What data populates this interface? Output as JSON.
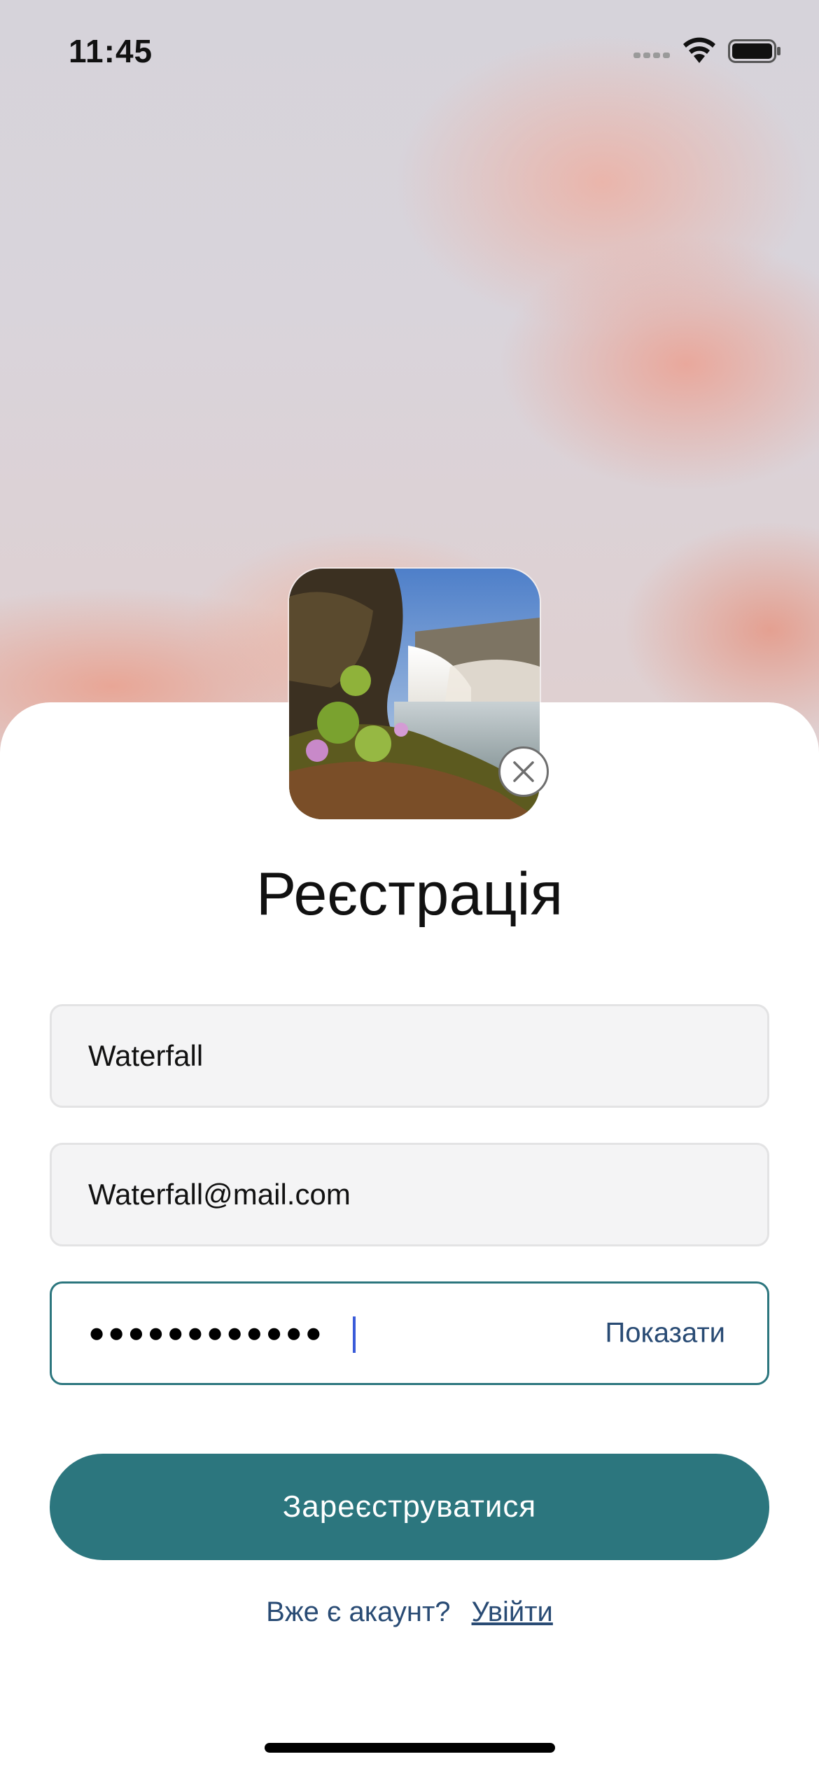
{
  "status_bar": {
    "time": "11:45",
    "icons": [
      "cellular-icon",
      "wifi-icon",
      "battery-icon"
    ]
  },
  "avatar": {
    "image": "waterfall-photo",
    "remove_icon": "close-circle-icon"
  },
  "title": "Реєстрація",
  "form": {
    "name_value": "Waterfall",
    "email_value": "Waterfall@mail.com",
    "password_masked": "●●●●●●●●●●●●",
    "show_password_label": "Показати"
  },
  "submit_label": "Зареєструватися",
  "login": {
    "question": "Вже є акаунт?",
    "link_label": "Увійти"
  },
  "colors": {
    "accent": "#2c767e",
    "link": "#294b74",
    "field_bg": "#f4f4f5"
  }
}
